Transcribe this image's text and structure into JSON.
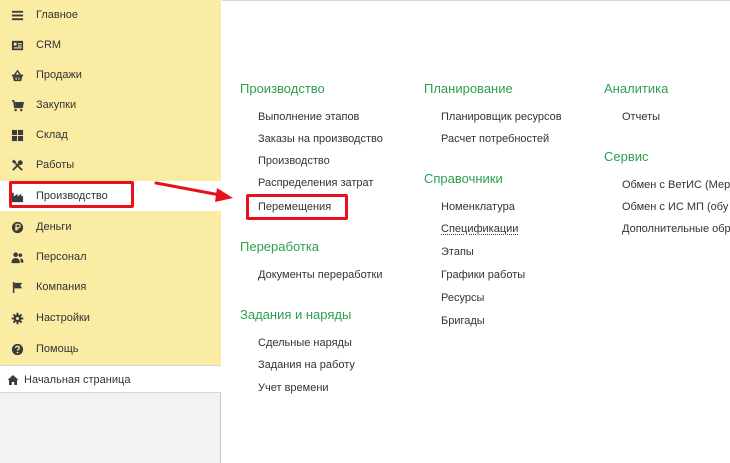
{
  "sidebar": {
    "items": [
      {
        "label": "Главное",
        "icon": "menu-lines-icon"
      },
      {
        "label": "CRM",
        "icon": "contact-card-icon"
      },
      {
        "label": "Продажи",
        "icon": "shopping-basket-icon"
      },
      {
        "label": "Закупки",
        "icon": "cart-icon"
      },
      {
        "label": "Склад",
        "icon": "warehouse-grid-icon"
      },
      {
        "label": "Работы",
        "icon": "tools-icon"
      },
      {
        "label": "Производство",
        "icon": "factory-icon"
      },
      {
        "label": "Деньги",
        "icon": "coin-icon"
      },
      {
        "label": "Персонал",
        "icon": "people-icon"
      },
      {
        "label": "Компания",
        "icon": "flag-icon"
      },
      {
        "label": "Настройки",
        "icon": "gear-icon"
      },
      {
        "label": "Помощь",
        "icon": "help-circle-icon"
      }
    ],
    "active_label": "Производство",
    "start_page": {
      "label": "Начальная страница",
      "icon": "home-icon"
    }
  },
  "main": {
    "columns": [
      {
        "sections": [
          {
            "title": "Производство",
            "links": [
              "Выполнение этапов",
              "Заказы на производство",
              "Производство",
              "Распределения затрат",
              "Перемещения"
            ]
          },
          {
            "title": "Переработка",
            "links": [
              "Документы переработки"
            ]
          },
          {
            "title": "Задания и наряды",
            "links": [
              "Сдельные наряды",
              "Задания на работу",
              "Учет времени"
            ]
          }
        ]
      },
      {
        "sections": [
          {
            "title": "Планирование",
            "links": [
              "Планировщик ресурсов",
              "Расчет потребностей"
            ]
          },
          {
            "title": "Справочники",
            "links": [
              "Номенклатура",
              "Спецификации",
              "Этапы",
              "Графики работы",
              "Ресурсы",
              "Бригады"
            ]
          }
        ]
      },
      {
        "sections": [
          {
            "title": "Аналитика",
            "links": [
              "Отчеты"
            ]
          },
          {
            "title": "Сервис",
            "links": [
              "Обмен с ВетИС (Мер",
              "Обмен с ИС МП (обу",
              "Дополнительные обр"
            ]
          }
        ]
      }
    ]
  },
  "colors": {
    "sidebar_bg": "#fbeca4",
    "section_title": "#2e9e50",
    "annotation_red": "#e8101c",
    "text": "#333333"
  }
}
